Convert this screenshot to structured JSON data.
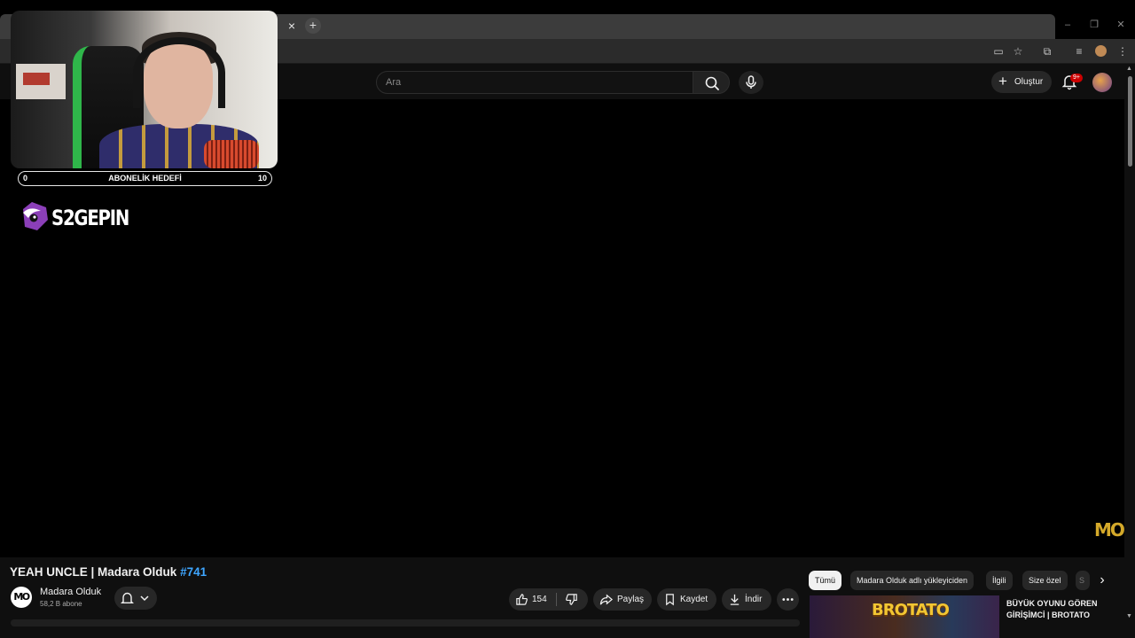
{
  "browser": {
    "tab_close": "×",
    "new_tab": "+",
    "window_controls": {
      "minimize": "–",
      "restore": "❐",
      "close": "✕"
    }
  },
  "masthead": {
    "search_placeholder": "Ara",
    "create_label": "Oluştur",
    "notification_badge": "9+"
  },
  "overlay": {
    "goal": {
      "min": "0",
      "label": "ABONELİK HEDEFİ",
      "max": "10",
      "progress": 0.0
    },
    "sponsor_text": "S2GEPIN"
  },
  "player": {
    "watermark": "MO"
  },
  "video": {
    "title_main": "YEAH UNCLE | Madara Olduk ",
    "title_tag": "#741",
    "channel_avatar_text": "MO",
    "channel_name": "Madara Olduk",
    "subscribers": "58,2 B abone",
    "likes": "154",
    "share_label": "Paylaş",
    "save_label": "Kaydet",
    "download_label": "İndir"
  },
  "recommendations": {
    "chips": [
      "Tümü",
      "Madara Olduk adlı yükleyiciden",
      "İlgili",
      "Size özel",
      "S"
    ],
    "first_title": "BÜYÜK OYUNU GÖREN GİRİŞİMCİ | BROTATO",
    "first_thumb_text": "BROTATO"
  },
  "colors": {
    "background": "#0f0f0f",
    "accent_link": "#3ea6ff",
    "badge": "#cc0000",
    "watermark": "#d4a92a"
  },
  "icons": [
    "search-icon",
    "mic-icon",
    "plus-icon",
    "bell-icon",
    "like-icon",
    "dislike-icon",
    "share-icon",
    "bookmark-icon",
    "download-icon",
    "more-icon",
    "chevron-right-icon"
  ]
}
